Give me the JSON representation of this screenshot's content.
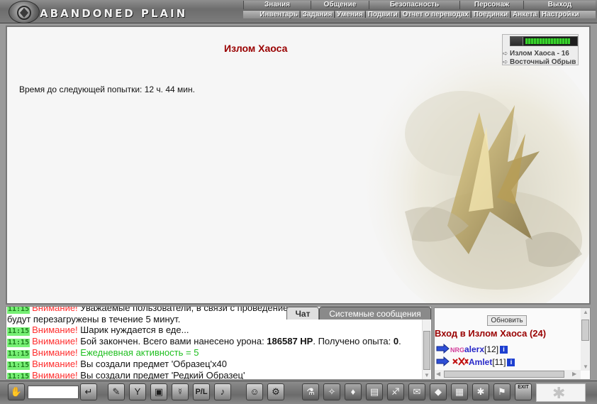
{
  "app": {
    "logo_text": "ABANDONED PLAIN"
  },
  "menu": {
    "top": [
      "Знания",
      "Общение",
      "Безопасность",
      "Персонаж",
      "Выход"
    ],
    "sub": [
      "Инвентарь",
      "Задания",
      "Умения",
      "Подвиги",
      "Отчет о переводах",
      "Поединки",
      "Анкета",
      "Настройки"
    ],
    "separator": "|"
  },
  "location": {
    "title": "Излом Хаоса",
    "timer_text": "Время до следующей попытки: 12 ч. 44 мин.",
    "links": [
      "Излом Хаоса - 16",
      "Восточный Обрыв"
    ],
    "link_arrow": "➪",
    "hp_fraction": 0.88
  },
  "chat": {
    "tabs": {
      "chat": "Чат",
      "system": "Системные сообщения"
    },
    "lines": [
      {
        "time": "11:15",
        "warn": "Внимание!",
        "text": "Уважаемые пользователи, в связи с проведением",
        "partial": true
      },
      {
        "time": "",
        "warn": "",
        "text": "будут перезагружены в течение 5 минут."
      },
      {
        "time": "11:15",
        "warn": "Внимание!",
        "text": "Шарик нуждается в еде..."
      },
      {
        "time": "11:15",
        "warn": "Внимание!",
        "pre": "Бой закончен. Всего вами нанесено урона: ",
        "bold1": "186587 HP",
        "mid": ". Получено опыта: ",
        "bold2": "0",
        "post": "."
      },
      {
        "time": "11:15",
        "warn": "Внимание!",
        "daily": "Ежедневная активность = 5"
      },
      {
        "time": "11:15",
        "warn": "Внимание!",
        "text": "Вы создали предмет 'Образец'x40"
      },
      {
        "time": "11:15",
        "warn": "Внимание!",
        "text": "Вы создали предмет 'Редкий Образец'"
      }
    ]
  },
  "players_panel": {
    "refresh_label": "Обновить",
    "title": "Вход в Излом Хаоса (24)",
    "players": [
      {
        "name": "alerx",
        "level": "[12]",
        "clan_tag": "NRG"
      },
      {
        "name": "Amlet",
        "level": "[11]",
        "clan_tag": ""
      }
    ],
    "info_icon_text": "i"
  },
  "toolbar": {
    "icons": [
      "chat-icon",
      "send-icon",
      "eraser-icon",
      "filter-icon",
      "save-icon",
      "walk-icon",
      "pl-icon",
      "audio-icon",
      "smile-icon",
      "inventory-icon",
      "potion-icon",
      "compass-icon",
      "bag-icon",
      "map-icon",
      "feather-icon",
      "scroll-icon",
      "shield-icon",
      "gift-icon",
      "group-icon",
      "flag-icon",
      "exit-icon",
      "gear-icon"
    ],
    "exit_label": "EXIT"
  },
  "colors": {
    "title_red": "#990000",
    "warn_red": "#ff2d2d",
    "daily_green": "#1fbf1f",
    "player_blue": "#2727c8",
    "time_bg": "#77f075"
  }
}
